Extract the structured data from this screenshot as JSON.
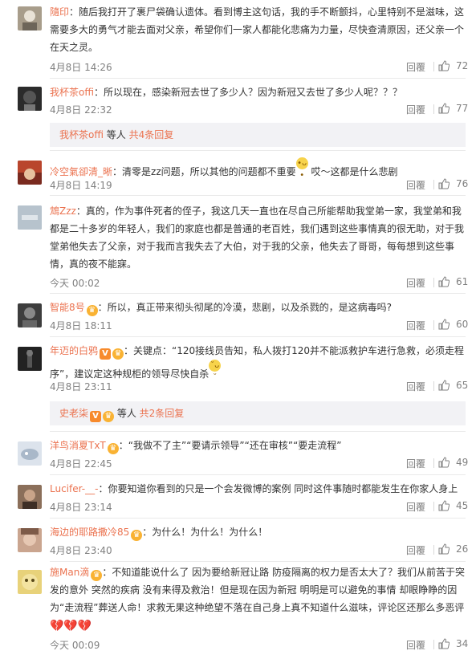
{
  "labels": {
    "reply": "回覆"
  },
  "colors": {
    "link": "#eb7350",
    "meta": "#808080",
    "subreply_bg": "#f2f2f5"
  },
  "comments": [
    {
      "user": "隨印",
      "text": "随后我打开了裹尸袋确认遗体。看到博主这句话，我的手不断颤抖，心里特别不是滋味，这需要多大的勇气才能去面对父亲，希望你们一家人都能化悲痛为力量，尽快查清原因，还父亲一个在天之灵。",
      "time": "4月8日 14:26",
      "likes": "72"
    },
    {
      "user": "我杯茶offi",
      "text": "所以现在，感染新冠去世了多少人？因为新冠又去世了多少人呢？？？",
      "time": "4月8日 22:32",
      "likes": "77",
      "subreply": {
        "user": "我杯茶offi",
        "middle": " 等人 ",
        "link": "共4条回复"
      }
    },
    {
      "user": "冷空氣卻清_晰",
      "text_before": "清零是zz问题，所以其他的问题都不重要",
      "emoji": "doge",
      "text_after": " 哎～这都是什么悲剧",
      "time": "4月8日 14:19",
      "likes": "76"
    },
    {
      "user": "鴆Zzz",
      "text": "真的，作为事件死者的侄子，我这几天一直也在尽自己所能帮助我堂弟一家，我堂弟和我都是二十多岁的年轻人，我们的家庭也都是普通的老百姓，我们遇到这些事情真的很无助，对于我堂弟他失去了父亲，对于我而言我失去了大伯，对于我的父亲，他失去了哥哥，每每想到这些事情，真的夜不能寐。",
      "time": "今天 00:02",
      "likes": "61"
    },
    {
      "user": "智能8号",
      "text": "所以，真正带来彻头彻尾的冷漠，悲剧，以及杀戮的，是这病毒吗?",
      "time": "4月8日 18:11",
      "likes": "60"
    },
    {
      "user": "年迈的白鸦",
      "text": "关键点：“120接线员告知，私人拨打120并不能派救护车进行急救，必须走程序”，建议定这种规柜的领导尽快自杀",
      "emoji": "sweat",
      "time": "4月8日 23:11",
      "likes": "65",
      "subreply": {
        "user": "史老柒",
        "middle": " 等人 ",
        "link": "共2条回复"
      }
    },
    {
      "user": "洋鸟消夏TxT",
      "text": "“我做不了主”“要请示领导”“还在审核”“要走流程”",
      "time": "4月8日 22:45",
      "likes": "49"
    },
    {
      "user": "Lucifer-__-",
      "text": "你要知道你看到的只是一个会发微博的案例 同时这件事随时都能发生在你家人身上",
      "time": "4月8日 23:14",
      "likes": "45"
    },
    {
      "user": "海边的耶路撒冷85",
      "text": "为什么！为什么！为什么！",
      "time": "4月8日 23:40",
      "likes": "26"
    },
    {
      "user": "施Man滴",
      "text": "不知道能说什么了 因为要给新冠让路 防疫隔离的权力是否太大了？我们从前苦于突发的意外 突然的疾病 没有来得及救治！但是现在因为新冠 明明是可以避免的事情 却眼睁睁的因为“走流程”葬送人命！求救无果这种绝望不落在自己身上真不知道什么滋味，评论区还那么多恶评",
      "hearts": "💔💔💔",
      "time": "今天 00:09",
      "likes": "34"
    }
  ]
}
